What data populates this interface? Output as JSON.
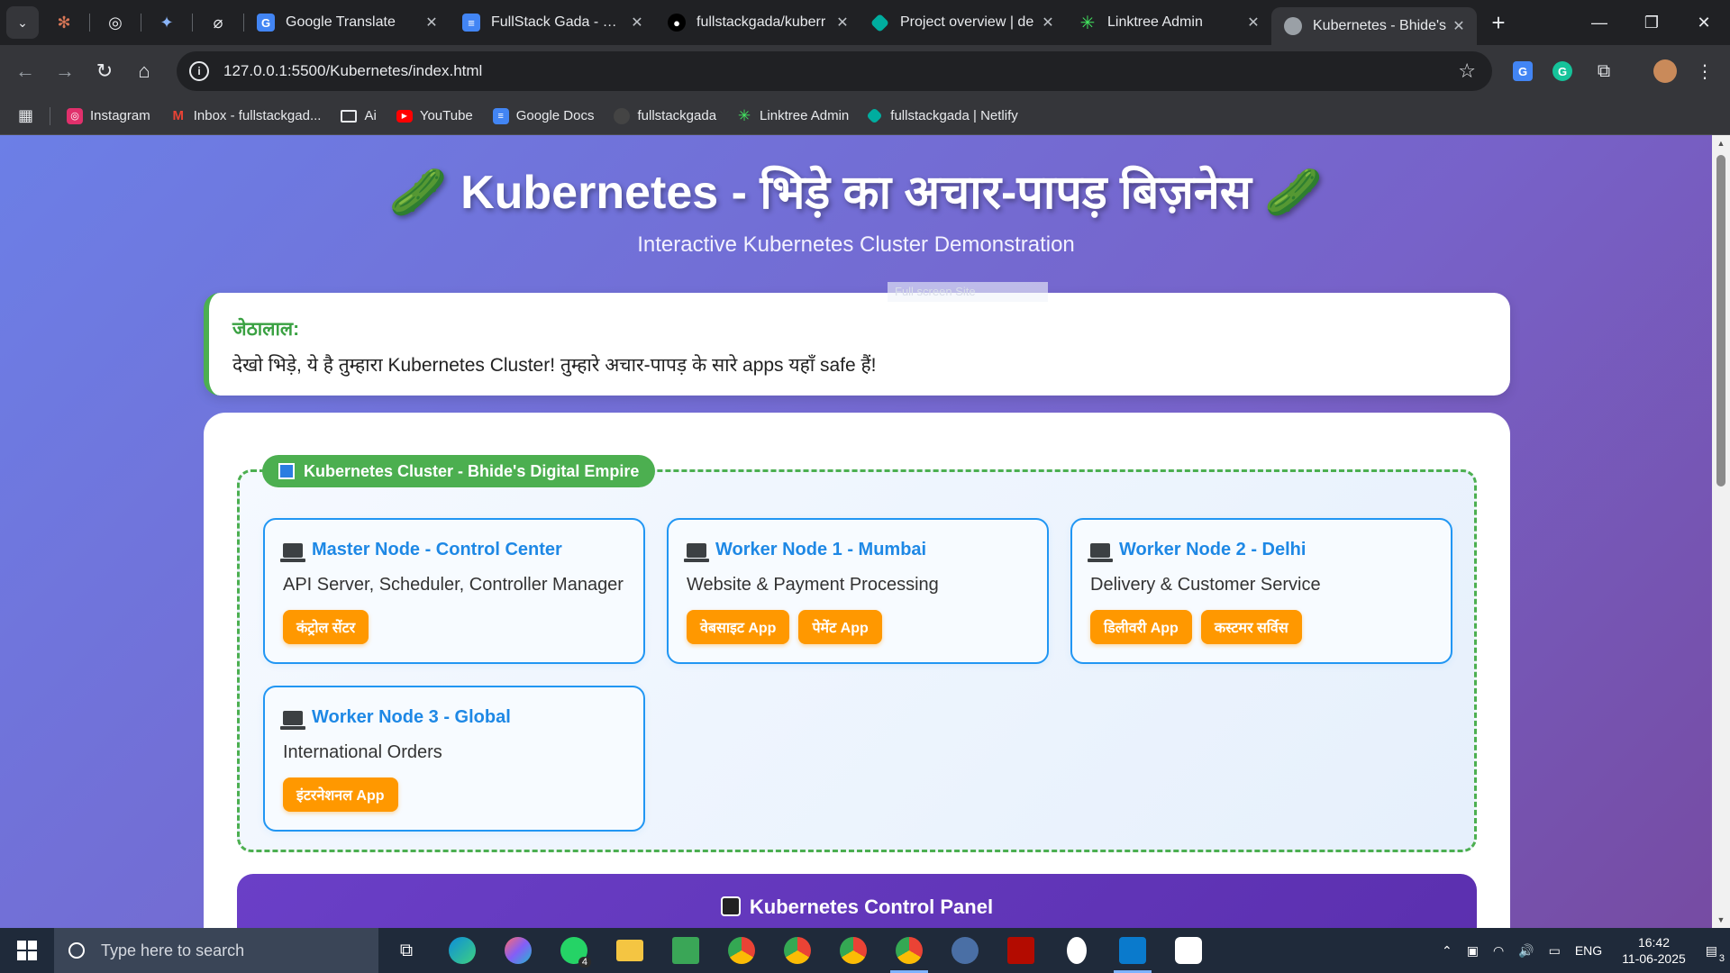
{
  "browser": {
    "tabs": [
      {
        "title": "Google Translate",
        "favicon": "#4285f4",
        "icon": "translate-icon"
      },
      {
        "title": "FullStack Gada - Goo",
        "favicon": "#4285f4",
        "icon": "docs-icon"
      },
      {
        "title": "fullstackgada/kuberr",
        "favicon": "#000000",
        "icon": "github-icon"
      },
      {
        "title": "Project overview | de",
        "favicon": "#00ad9f",
        "icon": "netlify-icon"
      },
      {
        "title": "Linktree Admin",
        "favicon": "#43e660",
        "icon": "linktree-icon"
      },
      {
        "title": "Kubernetes - Bhide's",
        "favicon": "#9aa0a6",
        "icon": "globe-icon",
        "active": true
      }
    ],
    "new_tab": "+",
    "url": "127.0.0.1:5500/Kubernetes/index.html",
    "bookmarks": [
      {
        "label": "Instagram",
        "color": "#e1306c"
      },
      {
        "label": "Inbox - fullstackgad...",
        "color": "#ea4335"
      },
      {
        "label": "Ai",
        "color": "#9aa0a6"
      },
      {
        "label": "YouTube",
        "color": "#ff0000"
      },
      {
        "label": "Google Docs",
        "color": "#4285f4"
      },
      {
        "label": "fullstackgada",
        "color": "#555555"
      },
      {
        "label": "Linktree Admin",
        "color": "#43e660"
      },
      {
        "label": "fullstackgada | Netlify",
        "color": "#00ad9f"
      }
    ]
  },
  "page": {
    "title": "🥒 Kubernetes - भिड़े का अचार-पापड़ बिज़नेस 🥒",
    "subtitle": "Interactive Kubernetes Cluster Demonstration",
    "dialogue": {
      "speaker": "जेठालाल:",
      "message": "देखो भिड़े, ये है तुम्हारा Kubernetes Cluster! तुम्हारे अचार-पापड़ के सारे apps यहाँ safe हैं!",
      "overlay_hint": "Full screen Site"
    },
    "cluster": {
      "label": "Kubernetes Cluster - Bhide's Digital Empire",
      "nodes": [
        {
          "title": "Master Node - Control Center",
          "desc": "API Server, Scheduler, Controller Manager",
          "pods": [
            "कंट्रोल सेंटर"
          ]
        },
        {
          "title": "Worker Node 1 - Mumbai",
          "desc": "Website & Payment Processing",
          "pods": [
            "वेबसाइट App",
            "पेमेंट App"
          ]
        },
        {
          "title": "Worker Node 2 - Delhi",
          "desc": "Delivery & Customer Service",
          "pods": [
            "डिलीवरी App",
            "कस्टमर सर्विस"
          ]
        },
        {
          "title": "Worker Node 3 - Global",
          "desc": "International Orders",
          "pods": [
            "इंटरनेशनल App"
          ]
        }
      ]
    },
    "control_panel": {
      "title": "Kubernetes Control Panel"
    }
  },
  "taskbar": {
    "search_placeholder": "Type here to search",
    "language": "ENG",
    "time": "16:42",
    "date": "11-06-2025",
    "whatsapp_badge": "4",
    "notification_count": "3"
  },
  "colors": {
    "accent_green": "#4caf50",
    "node_blue": "#2196f3",
    "pod_orange": "#ff9800",
    "control_purple": "#6a3fc7"
  }
}
